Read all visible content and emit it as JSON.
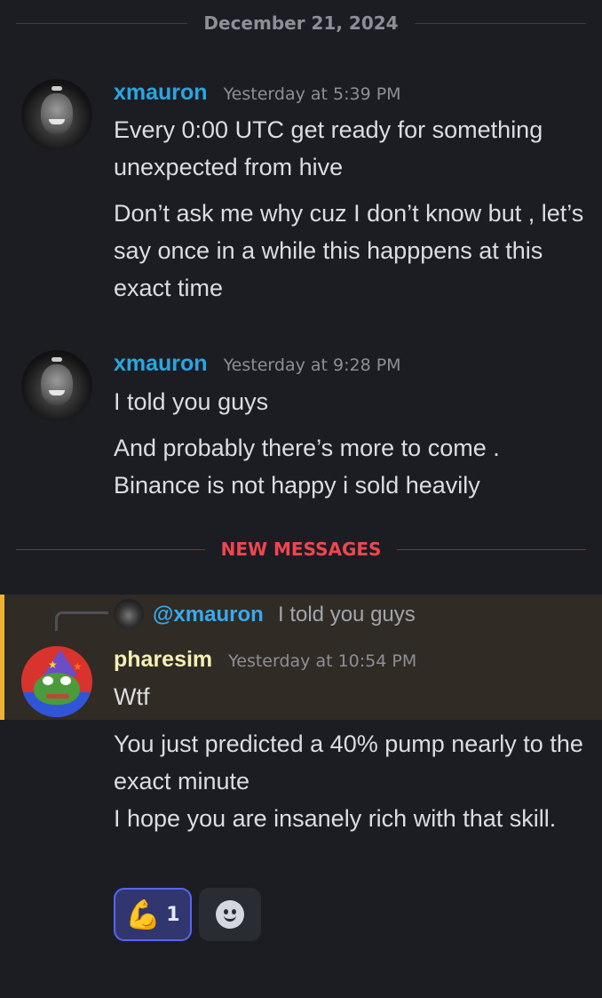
{
  "date_divider": "December 21, 2024",
  "messages": [
    {
      "author": "xmauron",
      "timestamp": "Yesterday at 5:39 PM",
      "lines": [
        "Every 0:00 UTC get ready for something unexpected from hive",
        "Don’t ask me why cuz I don’t know but , let’s say once in a while this happpens at this exact time"
      ]
    },
    {
      "author": "xmauron",
      "timestamp": "Yesterday at 9:28 PM",
      "lines": [
        "I told you guys",
        "And probably there’s more to come . Binance is not happy i sold heavily"
      ]
    },
    {
      "author": "pharesim",
      "timestamp": "Yesterday at 10:54 PM",
      "reply": {
        "mention": "@xmauron",
        "text": "I told you guys"
      },
      "lines": [
        "Wtf",
        "You just predicted a 40% pump nearly to the exact minute",
        "I hope you are insanely rich with that skill."
      ],
      "reactions": [
        {
          "emoji": "muscle-emoji",
          "glyph": "💪",
          "count": "1"
        }
      ]
    }
  ],
  "new_messages_label": "NEW MESSAGES",
  "colors": {
    "background": "#1c1d23",
    "author_blue": "#2aa6e0",
    "author_yellow": "#f6efb6",
    "new_messages_red": "#f0464f",
    "mention_highlight": "#302b25",
    "mention_bar": "#f0b232",
    "reaction_active": "#5865f2"
  }
}
